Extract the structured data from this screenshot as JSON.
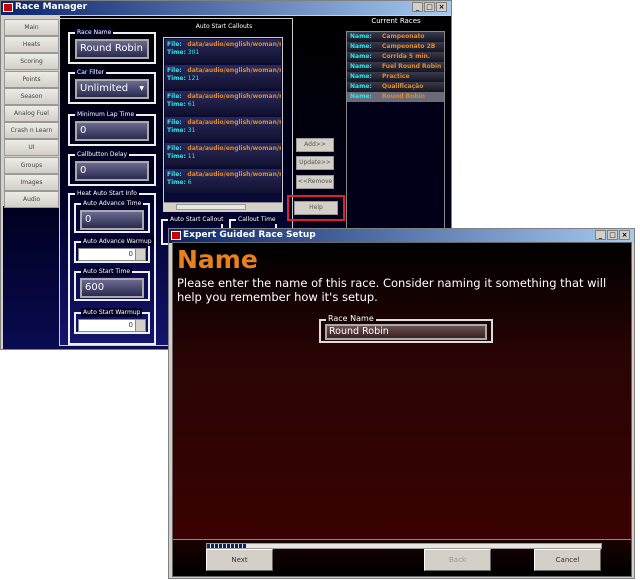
{
  "race_manager": {
    "title": "Race Manager",
    "window_buttons": [
      "_",
      "□",
      "×"
    ],
    "tabs": [
      "Main",
      "Heats",
      "Scoring",
      "Points",
      "Season",
      "Analog Fuel",
      "Crash n Learn",
      "UI",
      "Groups",
      "Images",
      "Audio"
    ],
    "race_name": {
      "label": "Race Name",
      "value": "Round Robin"
    },
    "car_filter": {
      "label": "Car Filter",
      "value": "Unlimited"
    },
    "min_lap_time": {
      "label": "Minimum Lap Time",
      "value": "0"
    },
    "callbutton_delay": {
      "label": "Callbutton Delay",
      "value": "0"
    },
    "heat_auto_start": {
      "label": "Heat Auto Start Info",
      "auto_advance_time": {
        "label": "Auto Advance Time",
        "value": "0"
      },
      "auto_advance_warmup": {
        "label": "Auto Advance Warmup",
        "value": "0"
      },
      "auto_start_time": {
        "label": "Auto Start Time",
        "value": "600"
      },
      "auto_start_warmup": {
        "label": "Auto Start Warmup",
        "value": "0"
      }
    },
    "callouts": {
      "title": "Auto Start Callouts",
      "file_label": "File:",
      "time_label": "Time:",
      "items": [
        {
          "file": "data/audio/english/woman/rs",
          "time": "301"
        },
        {
          "file": "data/audio/english/woman/rs",
          "time": "121"
        },
        {
          "file": "data/audio/english/woman/rs",
          "time": "61"
        },
        {
          "file": "data/audio/english/woman/rs",
          "time": "31"
        },
        {
          "file": "data/audio/english/woman/rs",
          "time": "11"
        },
        {
          "file": "data/audio/english/woman/rs",
          "time": "6"
        }
      ]
    },
    "auto_start_callout_label": "Auto Start Callout",
    "callout_time_label": "Callout Time",
    "buttons": {
      "add": "Add>>",
      "update": "Update>>",
      "remove": "<<Remove",
      "help": "Help"
    },
    "current_races": {
      "title": "Current Races",
      "name_label": "Name:",
      "items": [
        "Campeonato",
        "Campeonato 2B",
        "Corrida 5 min.",
        "Fuel Round Robin",
        "Practice",
        "Qualificação",
        "Round Robin"
      ],
      "selected": "Round Robin"
    }
  },
  "dialog": {
    "title": "Expert Guided Race Setup",
    "window_buttons": [
      "_",
      "□",
      "×"
    ],
    "heading": "Name",
    "description": "Please enter the name of this race.  Consider naming it something that will help you remember how it's setup.",
    "race_name": {
      "label": "Race Name",
      "value": "Round Robin"
    },
    "progress_percent": 10,
    "buttons": {
      "next": "Next",
      "back": "Back",
      "cancel": "Cancel"
    }
  },
  "colors": {
    "accent_orange": "#e8801e",
    "name_cyan": "#22e0e8",
    "highlight_red": "#e0202a"
  }
}
